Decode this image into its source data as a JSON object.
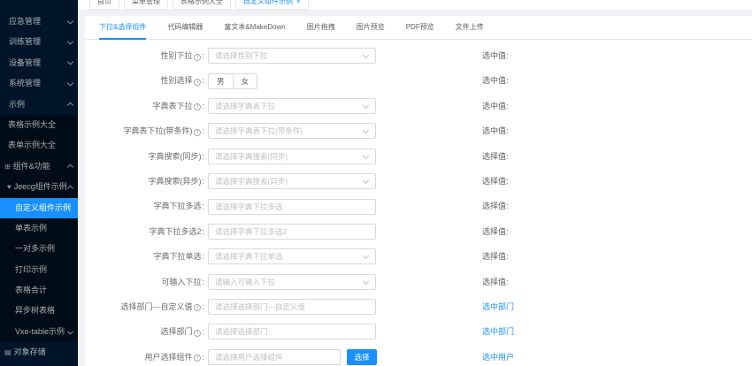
{
  "colors": {
    "accent": "#1890ff",
    "sidebar_bg": "#001529",
    "submenu_bg": "#000c17",
    "content_bg": "#f0f2f5",
    "card_bg": "#ffffff",
    "input_border": "#d9d9d9",
    "placeholder": "#bfbfbf"
  },
  "top_tabs": {
    "items": [
      {
        "label": "首页",
        "active": false,
        "closable": false
      },
      {
        "label": "菜单管理",
        "active": false,
        "closable": false
      },
      {
        "label": "表格示例大全",
        "active": false,
        "closable": false
      },
      {
        "label": "自定义组件示例",
        "active": true,
        "closable": true
      }
    ]
  },
  "sidebar": {
    "items": [
      {
        "label": "应急管理",
        "level": 1,
        "arrow": "down",
        "dark": false
      },
      {
        "label": "训练管理",
        "level": 1,
        "arrow": "down",
        "dark": false
      },
      {
        "label": "设备管理",
        "level": 1,
        "arrow": "down",
        "dark": false
      },
      {
        "label": "系统管理",
        "level": 1,
        "arrow": "down",
        "dark": false
      },
      {
        "label": "示例",
        "level": 1,
        "arrow": "up",
        "dark": false
      },
      {
        "label": "表格示例大全",
        "level": 2,
        "dark": true
      },
      {
        "label": "表单示例大全",
        "level": 2,
        "dark": true
      },
      {
        "label": "组件&功能",
        "level": 1,
        "arrow": "up",
        "icon": "grid",
        "dark": true
      },
      {
        "label": "Jeecg组件示例",
        "level": 2,
        "arrow": "up",
        "icon": "heart",
        "dark": true
      },
      {
        "label": "自定义组件示例",
        "level": 3,
        "active": true,
        "dark": true
      },
      {
        "label": "单表示例",
        "level": 3,
        "dark": true
      },
      {
        "label": "一对多示例",
        "level": 3,
        "dark": true
      },
      {
        "label": "打印示例",
        "level": 3,
        "dark": true
      },
      {
        "label": "表格合计",
        "level": 3,
        "dark": true
      },
      {
        "label": "异步树表格",
        "level": 3,
        "dark": true
      },
      {
        "label": "Vxe-table示例",
        "level": 3,
        "arrow": "down",
        "dark": true
      },
      {
        "label": "对象存储",
        "level": 1,
        "icon": "storage",
        "dark": false
      }
    ]
  },
  "content": {
    "tabs": [
      {
        "label": "下拉&选择组件",
        "active": true
      },
      {
        "label": "代码编辑器",
        "active": false
      },
      {
        "label": "富文本&MakeDown",
        "active": false
      },
      {
        "label": "图片拖拽",
        "active": false
      },
      {
        "label": "图片预览",
        "active": false
      },
      {
        "label": "PDF预览",
        "active": false
      },
      {
        "label": "文件上传",
        "active": false
      }
    ],
    "form": {
      "rows": [
        {
          "label": "性别下拉",
          "info": true,
          "control": "select",
          "placeholder": "请选择性别下拉",
          "right": "选中值:",
          "blue": false
        },
        {
          "label": "性别选择",
          "info": true,
          "control": "radio",
          "options": [
            "男",
            "女"
          ],
          "right": "选中值:",
          "blue": false
        },
        {
          "label": "字典表下拉",
          "info": true,
          "control": "select",
          "placeholder": "请选择字典表下拉",
          "right": "选中值:",
          "blue": false
        },
        {
          "label": "字典表下拉(带条件)",
          "info": true,
          "control": "select",
          "placeholder": "请选择字典表下拉(带条件)",
          "right": "选中值:",
          "blue": false
        },
        {
          "label": "字典搜索(同步)",
          "info": false,
          "control": "select",
          "placeholder": "请选择字典搜索(同步)",
          "right": "选择值:",
          "blue": false
        },
        {
          "label": "字典搜索(异步)",
          "info": false,
          "control": "select",
          "placeholder": "请选择字典搜索(异步)",
          "right": "选择值:",
          "blue": false
        },
        {
          "label": "字典下拉多选",
          "info": false,
          "control": "input",
          "placeholder": "请选择字典下拉多选",
          "right": "选择值:",
          "blue": false
        },
        {
          "label": "字典下拉多选2",
          "info": false,
          "control": "input",
          "placeholder": "请选择字典下拉多选2",
          "right": "选择值:",
          "blue": false
        },
        {
          "label": "字典下拉单选",
          "info": false,
          "control": "select",
          "placeholder": "请选择字典下拉单选",
          "right": "选择值:",
          "blue": false
        },
        {
          "label": "可输入下拉",
          "info": false,
          "control": "select",
          "placeholder": "请输入可输入下拉",
          "right": "选择值:",
          "blue": false
        },
        {
          "label": "选择部门—自定义值",
          "info": true,
          "control": "input",
          "placeholder": "请选择选择部门—自定义值",
          "right": "选中部门",
          "blue": true
        },
        {
          "label": "选择部门",
          "info": true,
          "control": "input",
          "placeholder": "请选择选择部门",
          "right": "选中部门",
          "blue": true
        },
        {
          "label": "用户选择组件",
          "info": true,
          "control": "input-button",
          "placeholder": "请选择用户选择组件",
          "button": "选择",
          "right": "选中用户",
          "blue": true
        }
      ]
    }
  }
}
